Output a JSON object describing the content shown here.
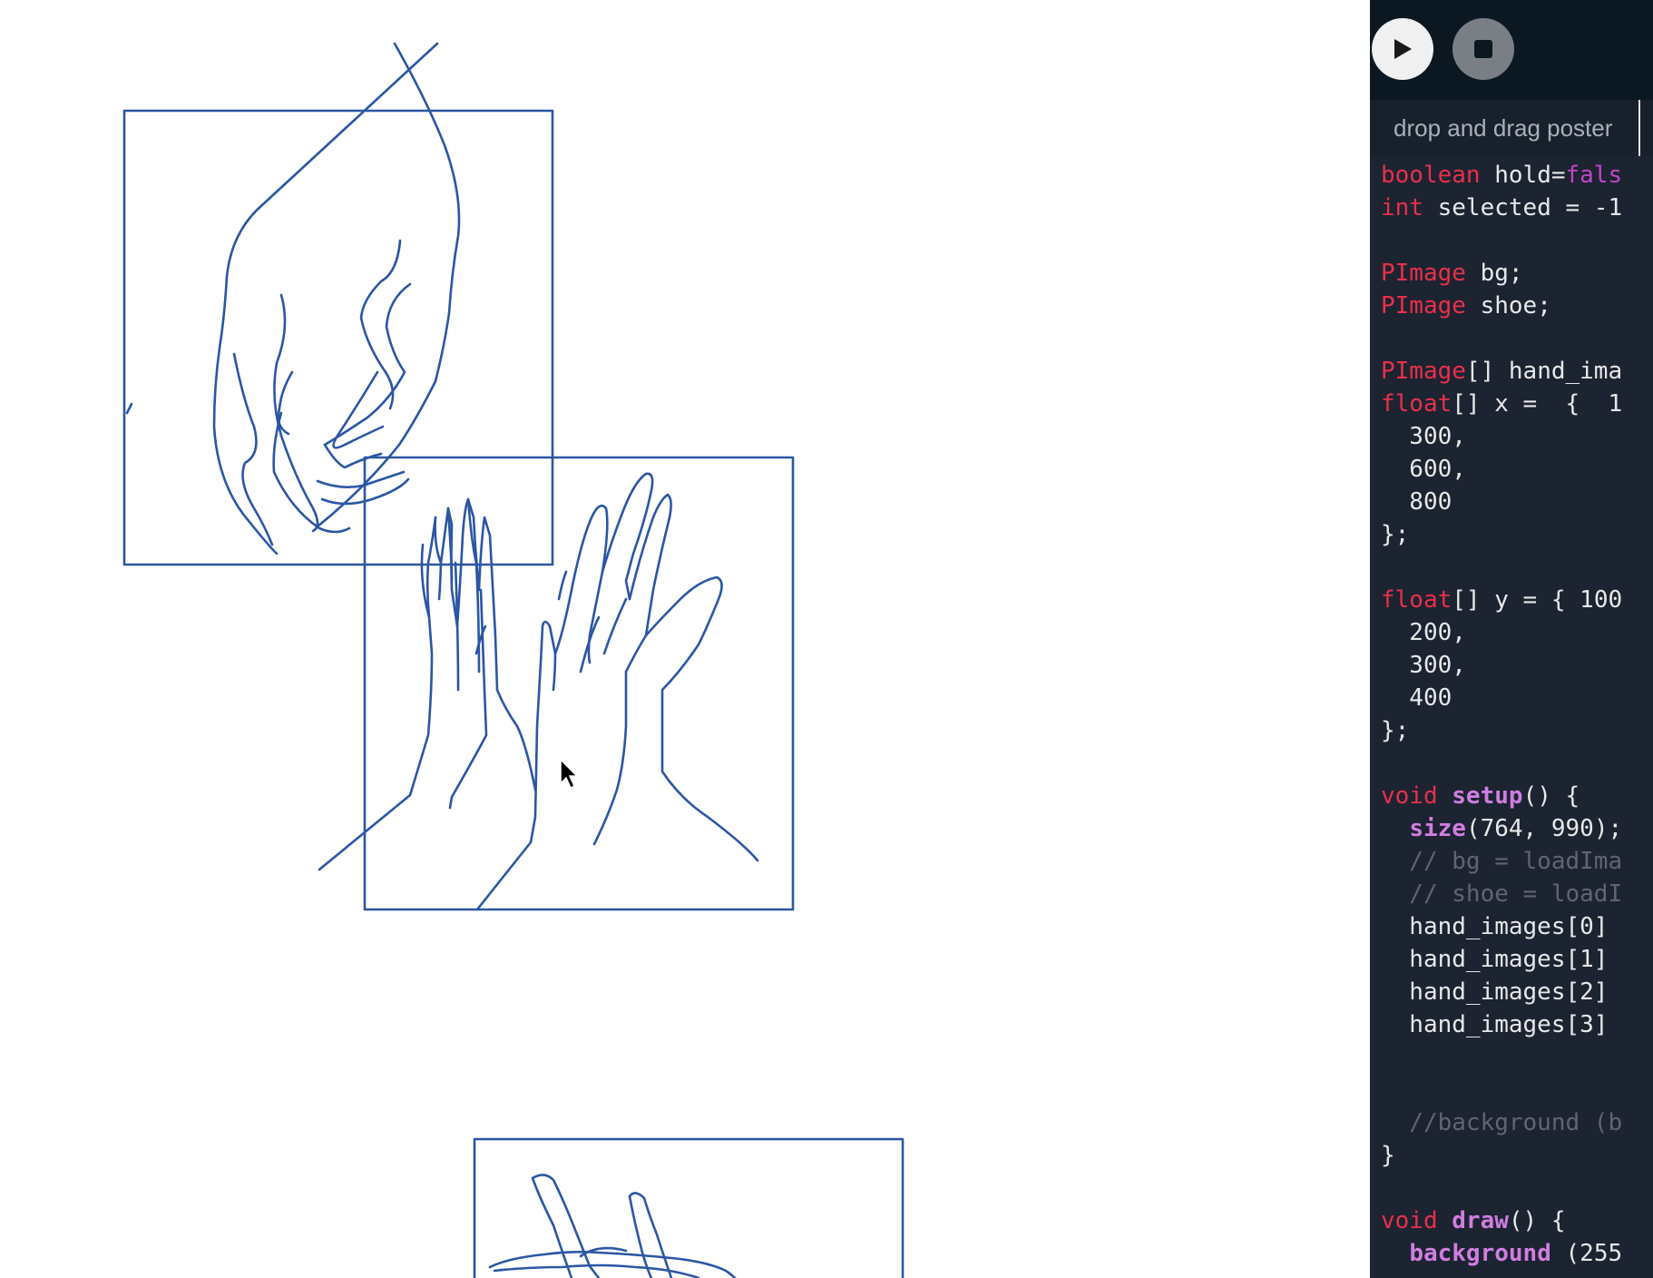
{
  "toolbar": {
    "run_label": "Run",
    "stop_label": "Stop"
  },
  "tab": {
    "label": "drop and drag poster"
  },
  "code": {
    "lines": [
      [
        {
          "t": "boolean",
          "c": "kw"
        },
        {
          "t": " hold=",
          "c": ""
        },
        {
          "t": "fals",
          "c": "lit"
        }
      ],
      [
        {
          "t": "int",
          "c": "kw"
        },
        {
          "t": " selected = -1",
          "c": ""
        }
      ],
      [],
      [
        {
          "t": "PImage",
          "c": "kw"
        },
        {
          "t": " bg;",
          "c": ""
        }
      ],
      [
        {
          "t": "PImage",
          "c": "kw"
        },
        {
          "t": " shoe;",
          "c": ""
        }
      ],
      [],
      [
        {
          "t": "PImage",
          "c": "kw"
        },
        {
          "t": "[] hand_ima",
          "c": ""
        }
      ],
      [
        {
          "t": "float",
          "c": "kw"
        },
        {
          "t": "[] x =  {  1",
          "c": ""
        }
      ],
      [
        {
          "t": "  300,",
          "c": ""
        }
      ],
      [
        {
          "t": "  600,",
          "c": ""
        }
      ],
      [
        {
          "t": "  800",
          "c": ""
        }
      ],
      [
        {
          "t": "};",
          "c": ""
        }
      ],
      [],
      [
        {
          "t": "float",
          "c": "kw"
        },
        {
          "t": "[] y = { 100",
          "c": ""
        }
      ],
      [
        {
          "t": "  200,",
          "c": ""
        }
      ],
      [
        {
          "t": "  300,",
          "c": ""
        }
      ],
      [
        {
          "t": "  400",
          "c": ""
        }
      ],
      [
        {
          "t": "};",
          "c": ""
        }
      ],
      [],
      [
        {
          "t": "void",
          "c": "kw"
        },
        {
          "t": " ",
          "c": ""
        },
        {
          "t": "setup",
          "c": "fn"
        },
        {
          "t": "() {",
          "c": ""
        }
      ],
      [
        {
          "t": "  ",
          "c": ""
        },
        {
          "t": "size",
          "c": "fn"
        },
        {
          "t": "(764, 990);",
          "c": ""
        }
      ],
      [
        {
          "t": "  // bg = loadIma",
          "c": "cm"
        }
      ],
      [
        {
          "t": "  // shoe = loadI",
          "c": "cm"
        }
      ],
      [
        {
          "t": "  hand_images[0]",
          "c": ""
        }
      ],
      [
        {
          "t": "  hand_images[1]",
          "c": ""
        }
      ],
      [
        {
          "t": "  hand_images[2]",
          "c": ""
        }
      ],
      [
        {
          "t": "  hand_images[3]",
          "c": ""
        }
      ],
      [],
      [],
      [
        {
          "t": "  //background (b",
          "c": "cm"
        }
      ],
      [
        {
          "t": "}",
          "c": ""
        }
      ],
      [],
      [
        {
          "t": "void",
          "c": "kw"
        },
        {
          "t": " ",
          "c": ""
        },
        {
          "t": "draw",
          "c": "fn"
        },
        {
          "t": "() {",
          "c": ""
        }
      ],
      [
        {
          "t": "  ",
          "c": ""
        },
        {
          "t": "background",
          "c": "fn"
        },
        {
          "t": " (255",
          "c": ""
        }
      ]
    ]
  },
  "icons": {
    "run": "play-icon",
    "stop": "stop-icon",
    "cursor": "mouse-pointer-icon"
  },
  "colors": {
    "line_art": "#2a56a4",
    "editor_bg": "#1c2331",
    "keyword": "#e8304a",
    "function": "#d07ee0",
    "comment": "#5f6670",
    "literal": "#c244c8"
  }
}
